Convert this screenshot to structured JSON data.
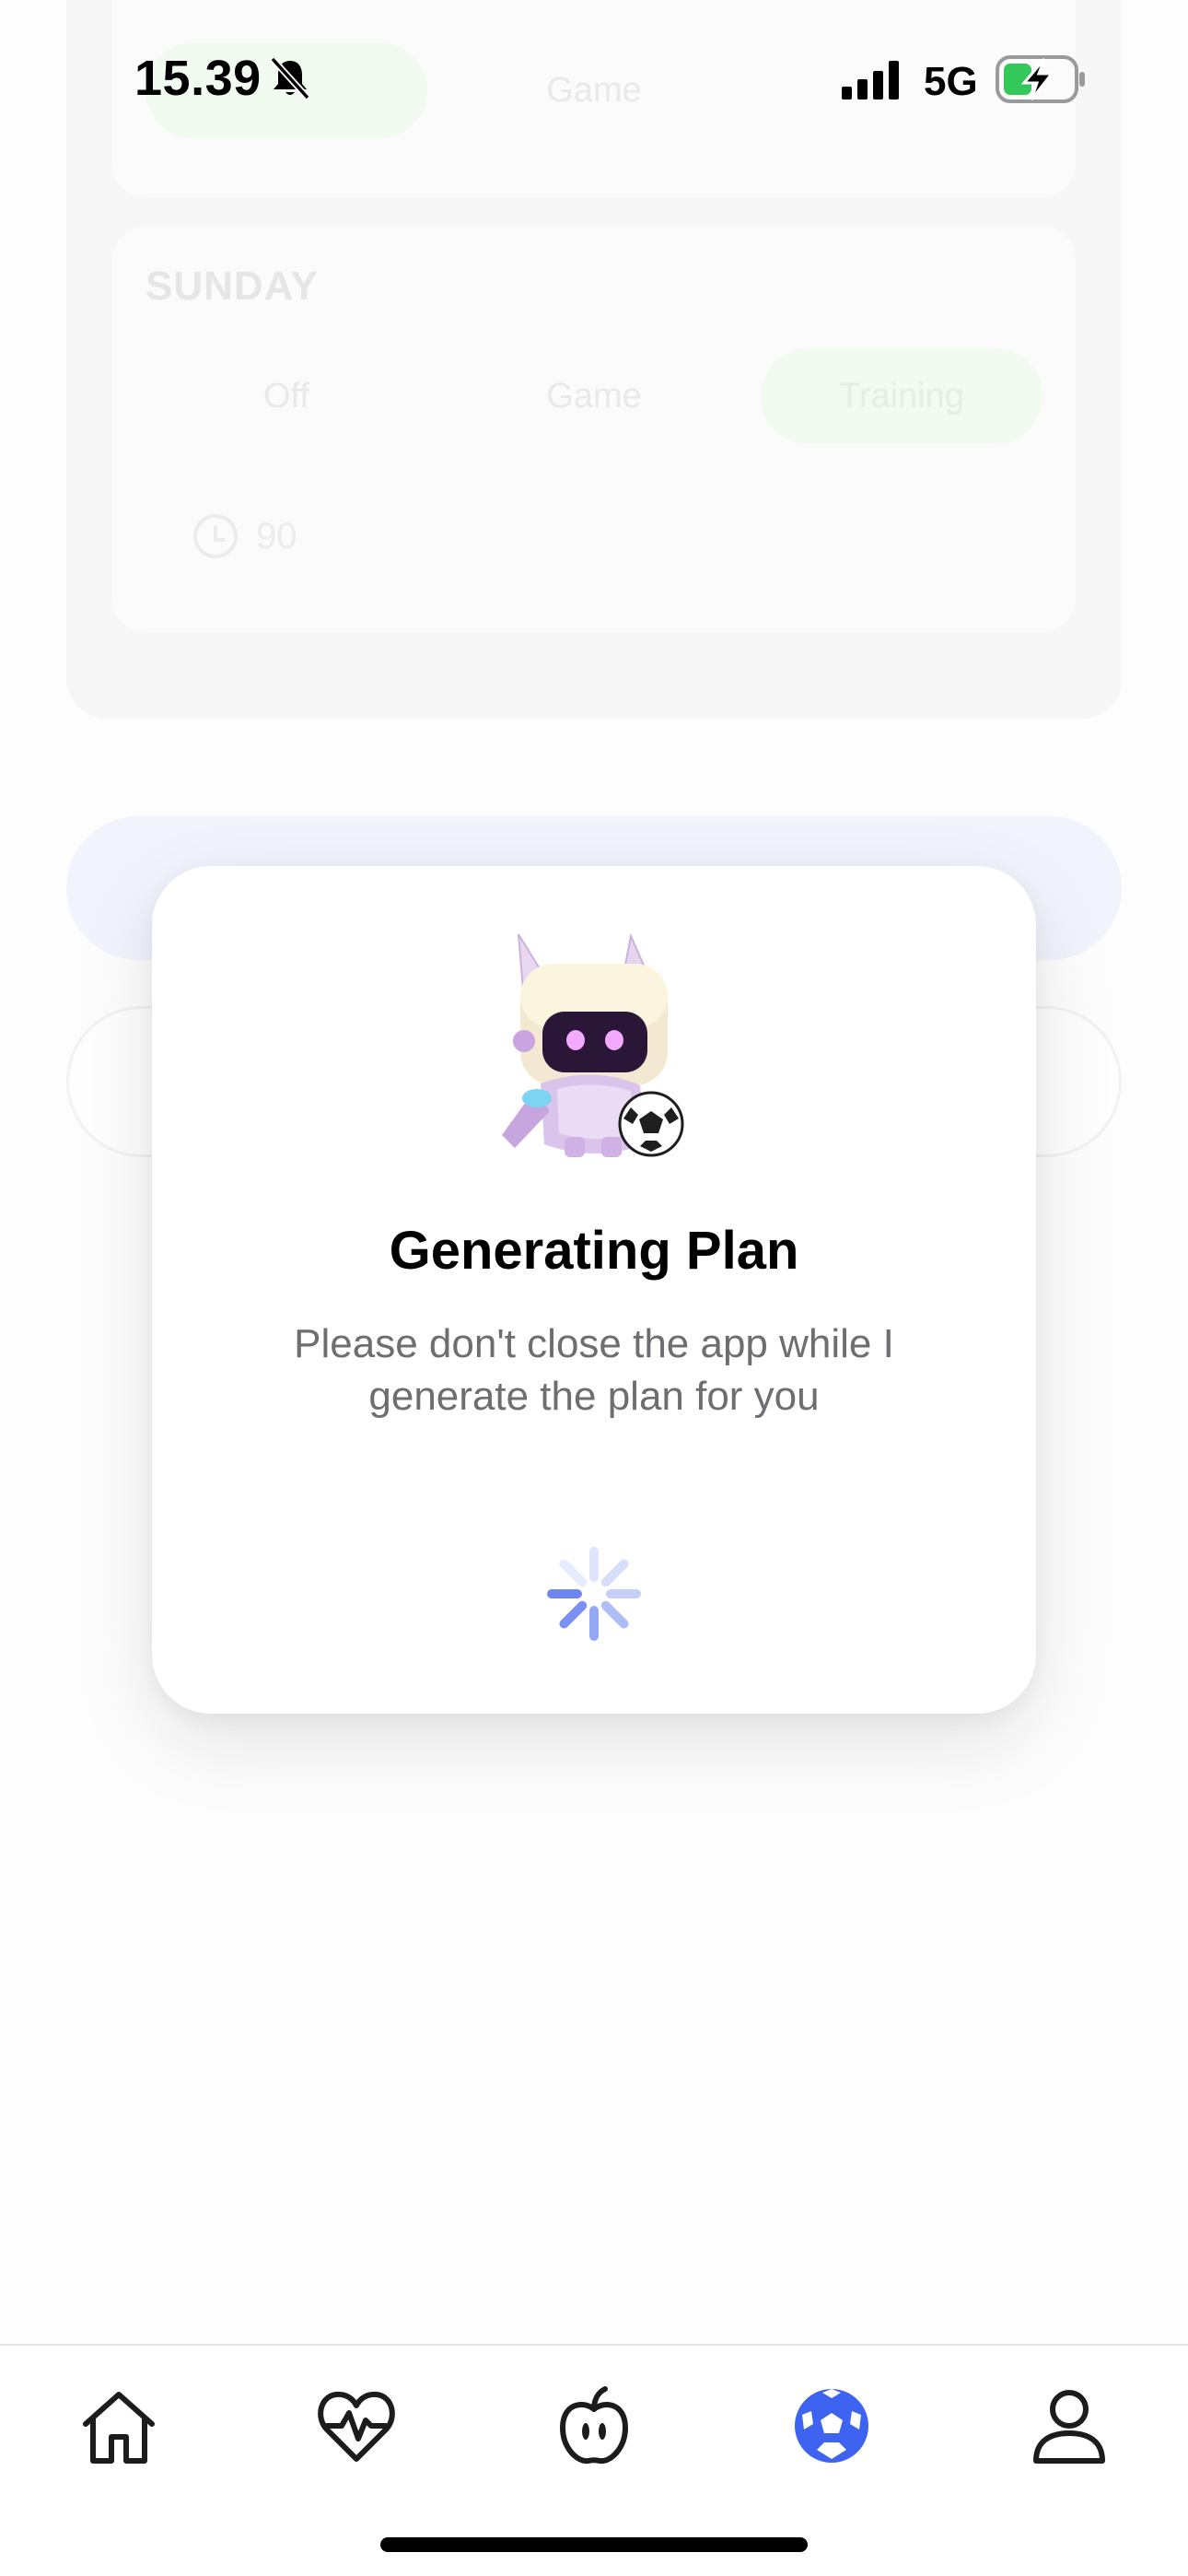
{
  "status_bar": {
    "time": "15.39",
    "network": "5G",
    "icons": [
      "bell-slash-icon",
      "signal-bars-icon",
      "battery-charging-icon"
    ]
  },
  "background": {
    "previous_day_options": [
      "Game"
    ],
    "day_label": "SUNDAY",
    "day_options": [
      "Off",
      "Game",
      "Training"
    ],
    "selected_option": "Training",
    "duration": "90"
  },
  "modal": {
    "title": "Generating Plan",
    "message": "Please don't close the app while I generate the plan for you",
    "mascot": "robot-with-soccer-ball",
    "loading": true
  },
  "tab_bar": {
    "items": [
      {
        "icon": "home-icon",
        "active": false
      },
      {
        "icon": "heart-pulse-icon",
        "active": false
      },
      {
        "icon": "apple-icon",
        "active": false
      },
      {
        "icon": "soccer-ball-icon",
        "active": true
      },
      {
        "icon": "profile-icon",
        "active": false
      }
    ],
    "active_color": "#3d63f0",
    "inactive_color": "#1c1c1e"
  },
  "colors": {
    "accent": "#3d63f0",
    "spinner": "#6f86f2",
    "selected_option_bg": "#f1fbef"
  }
}
